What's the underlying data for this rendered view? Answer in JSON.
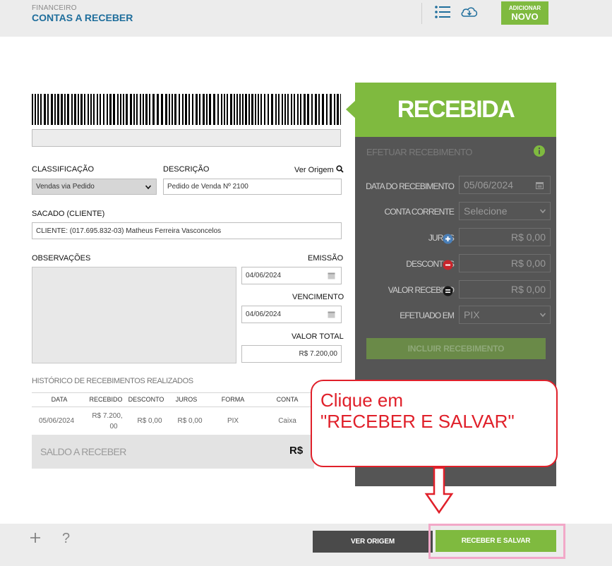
{
  "header": {
    "module": "FINANCEIRO",
    "page": "CONTAS A RECEBER",
    "add_button": {
      "line1": "ADICIONAR",
      "line2": "NOVO"
    }
  },
  "form": {
    "classificacao": {
      "label": "CLASSIFICAÇÃO",
      "value": "Vendas via Pedido"
    },
    "descricao": {
      "label": "DESCRIÇÃO",
      "value": "Pedido de Venda Nº 2100",
      "link": "Ver Origem"
    },
    "sacado": {
      "label": "SACADO (CLIENTE)",
      "value": "CLIENTE: (017.695.832-03) Matheus Ferreira Vasconcelos"
    },
    "observacoes": {
      "label": "OBSERVAÇÕES"
    },
    "emissao": {
      "label": "EMISSÃO",
      "value": "04/06/2024"
    },
    "vencimento": {
      "label": "VENCIMENTO",
      "value": "04/06/2024"
    },
    "valor_total": {
      "label": "VALOR TOTAL",
      "value": "R$ 7.200,00"
    }
  },
  "history": {
    "title": "HISTÓRICO DE RECEBIMENTOS REALIZADOS",
    "columns": [
      "DATA",
      "RECEBIDO",
      "DESCONTO",
      "JUROS",
      "FORMA",
      "CONTA"
    ],
    "rows": [
      {
        "data": "05/06/2024",
        "recebido_l1": "R$ 7.200,",
        "recebido_l2": "00",
        "desconto": "R$ 0,00",
        "juros": "R$ 0,00",
        "forma": "PIX",
        "conta": "Caixa"
      }
    ],
    "saldo_label": "SALDO A RECEBER",
    "saldo_value": "R$"
  },
  "status": {
    "text": "RECEBIDA"
  },
  "panel": {
    "title": "EFETUAR RECEBIMENTO",
    "data_recebimento": {
      "label": "DATA DO RECEBIMENTO",
      "value": "05/06/2024"
    },
    "conta_corrente": {
      "label": "CONTA CORRENTE",
      "value": "Selecione"
    },
    "juros": {
      "label": "JUROS",
      "value": "R$ 0,00"
    },
    "descontos": {
      "label": "DESCONTOS",
      "value": "R$ 0,00"
    },
    "valor_recebido": {
      "label": "VALOR RECEBIDO",
      "value": "R$ 0,00"
    },
    "efetuado_em": {
      "label": "EFETUADO EM",
      "value": "PIX"
    },
    "incluir_button": "INCLUIR RECEBIMENTO"
  },
  "callout": {
    "text": "Clique em\n\"RECEBER E SALVAR\""
  },
  "footer": {
    "help": "?",
    "ver_origem": "VER ORIGEM",
    "receber_salvar": "RECEBER E SALVAR"
  },
  "colors": {
    "green": "#7fba3f",
    "blue": "#1f6e9c",
    "panel": "#555555",
    "callout_red": "#e0202a",
    "highlight_pink": "#f2a8c8"
  }
}
